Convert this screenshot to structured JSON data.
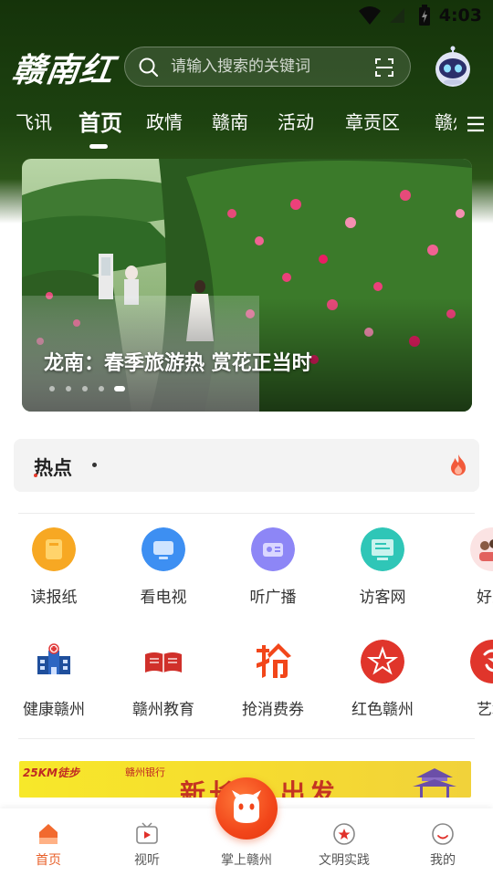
{
  "status_bar": {
    "time": "4:03"
  },
  "header": {
    "logo_text": "赣南红",
    "search": {
      "placeholder": "请输入搜索的关键词"
    },
    "tabs": [
      {
        "label": "飞讯",
        "active": false
      },
      {
        "label": "首页",
        "active": true
      },
      {
        "label": "政情",
        "active": false
      },
      {
        "label": "赣南",
        "active": false
      },
      {
        "label": "活动",
        "active": false
      },
      {
        "label": "章贡区",
        "active": false
      },
      {
        "label": "赣州",
        "active": false
      }
    ]
  },
  "banner": {
    "title": "龙南：春季旅游热 赏花正当时",
    "page_count": 5,
    "active_page": 5
  },
  "hot": {
    "label": "热点"
  },
  "grid": [
    {
      "label": "读报纸",
      "icon": "newspaper-icon",
      "color": "#f5a623"
    },
    {
      "label": "看电视",
      "icon": "tv-icon",
      "color": "#3b8ef0"
    },
    {
      "label": "听广播",
      "icon": "radio-icon",
      "color": "#8b84f5"
    },
    {
      "label": "访客网",
      "icon": "visitor-icon",
      "color": "#2ec4b6"
    },
    {
      "label": "好人",
      "icon": "good-people-icon",
      "color": "#f2a0a0"
    },
    {
      "label": "健康赣州",
      "icon": "hospital-icon",
      "color": "#1f4f9c"
    },
    {
      "label": "赣州教育",
      "icon": "book-icon",
      "color": "#d0302a"
    },
    {
      "label": "抢消费券",
      "icon": "coupon-icon",
      "color": "#f2461a"
    },
    {
      "label": "红色赣州",
      "icon": "red-star-icon",
      "color": "#e0302a"
    },
    {
      "label": "艺赣",
      "icon": "art-icon",
      "color": "#e0302a"
    }
  ],
  "ad": {
    "left_text": "25KM徒步",
    "bank_text": "赣州银行",
    "big_text": "新长征 出发"
  },
  "bottom_nav": [
    {
      "label": "首页",
      "active": true
    },
    {
      "label": "视听",
      "active": false
    },
    {
      "label": "掌上赣州",
      "active": false
    },
    {
      "label": "文明实践",
      "active": false
    },
    {
      "label": "我的",
      "active": false
    }
  ],
  "colors": {
    "accent": "#e8602a",
    "header_green": "#1d4210"
  }
}
